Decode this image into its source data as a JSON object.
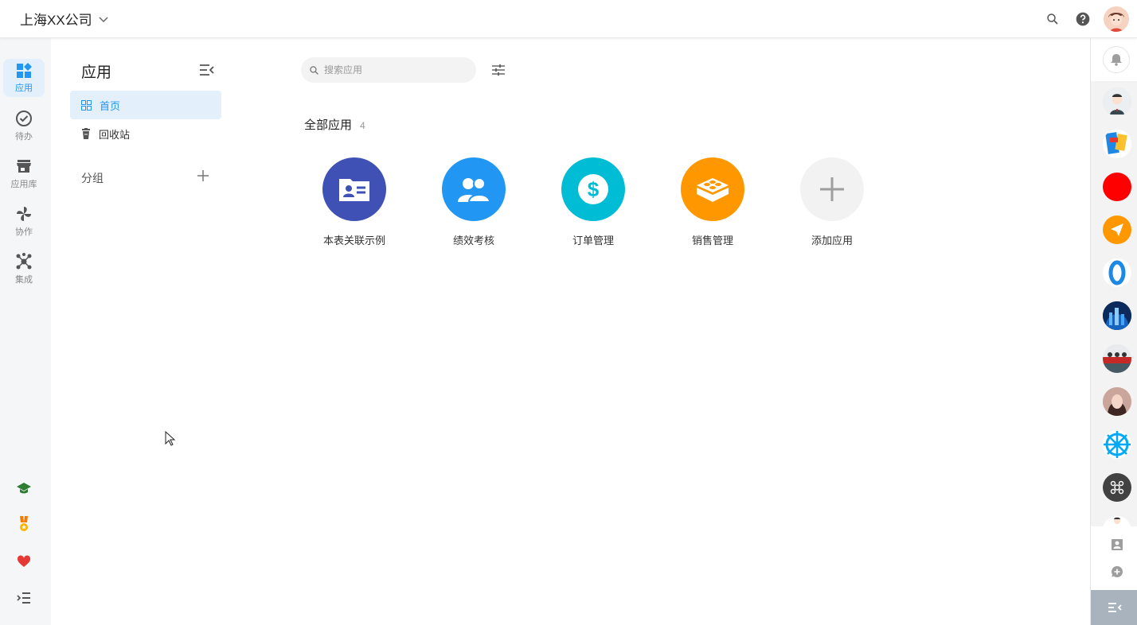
{
  "header": {
    "company": "上海XX公司"
  },
  "leftnav": {
    "items": [
      {
        "label": "应用",
        "icon": "apps-icon",
        "active": true
      },
      {
        "label": "待办",
        "icon": "check-circle-icon"
      },
      {
        "label": "应用库",
        "icon": "store-icon"
      },
      {
        "label": "协作",
        "icon": "pinwheel-icon"
      },
      {
        "label": "集成",
        "icon": "hub-icon"
      }
    ],
    "bottom_icons": [
      "graduation-cap-icon",
      "medal-icon",
      "heart-icon",
      "expand-menu-icon"
    ]
  },
  "panel": {
    "title": "应用",
    "menu": [
      {
        "label": "首页",
        "icon": "grid-icon",
        "active": true
      },
      {
        "label": "回收站",
        "icon": "trash-icon"
      }
    ],
    "group_title": "分组"
  },
  "main": {
    "search_placeholder": "搜索应用",
    "section_title": "全部应用",
    "count": "4",
    "apps": [
      {
        "name": "本表关联示例",
        "icon": "id-card-icon",
        "color": "#3f51b5"
      },
      {
        "name": "绩效考核",
        "icon": "users-icon",
        "color": "#2196f3"
      },
      {
        "name": "订单管理",
        "icon": "dollar-icon",
        "color": "#00bcd4"
      },
      {
        "name": "销售管理",
        "icon": "brick-icon",
        "color": "#ff9800"
      },
      {
        "name": "添加应用",
        "icon": "plus-icon",
        "color": "#f2f2f2"
      }
    ]
  },
  "colors": {
    "accent": "#2196f3",
    "nav_bg": "#f5f6f8",
    "active_bg": "#e3f0fc"
  }
}
